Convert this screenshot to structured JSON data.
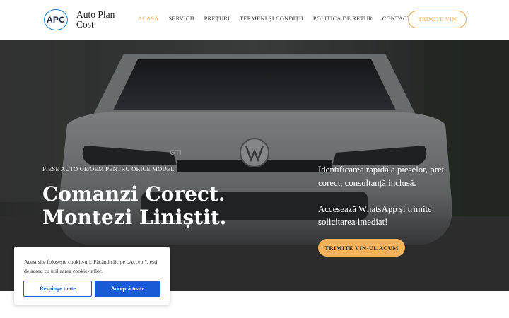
{
  "header": {
    "logo_abbr": "APC",
    "logo_text": "Auto Plan Cost",
    "nav": [
      {
        "label": "ACASĂ",
        "active": true
      },
      {
        "label": "SERVICII",
        "active": false
      },
      {
        "label": "PREȚURI",
        "active": false
      },
      {
        "label": "TERMENI ȘI CONDIȚII",
        "active": false
      },
      {
        "label": "POLITICA DE RETUR",
        "active": false
      },
      {
        "label": "CONTACT",
        "active": false
      }
    ],
    "cta_label": "TRIMITE VIN"
  },
  "hero": {
    "eyebrow": "PIESE AUTO OE/OEM PENTRU ORICE MODEL",
    "headline": "Comanzi Corect. Montezi Liniștit.",
    "paragraphs": [
      "Identificarea rapidă a pieselor, preț corect, consultanță inclusă.",
      "Accesează WhatsApp și trimite solicitarea imediat!"
    ],
    "cta_label": "TRIMITE VIN-UL ACUM",
    "badge_text": "GTI"
  },
  "cookie": {
    "text": "Acest site folosește cookie-uri. Făcând clic pe „Accept\", ești de acord cu utilizarea cookie-urilor.",
    "reject_label": "Respinge toate",
    "accept_label": "Acceptă toate"
  },
  "colors": {
    "accent": "#f0a94c",
    "accent_fill": "#f6b35c",
    "logo_ring": "#1e88c7",
    "cookie_blue": "#1a5bd6"
  }
}
